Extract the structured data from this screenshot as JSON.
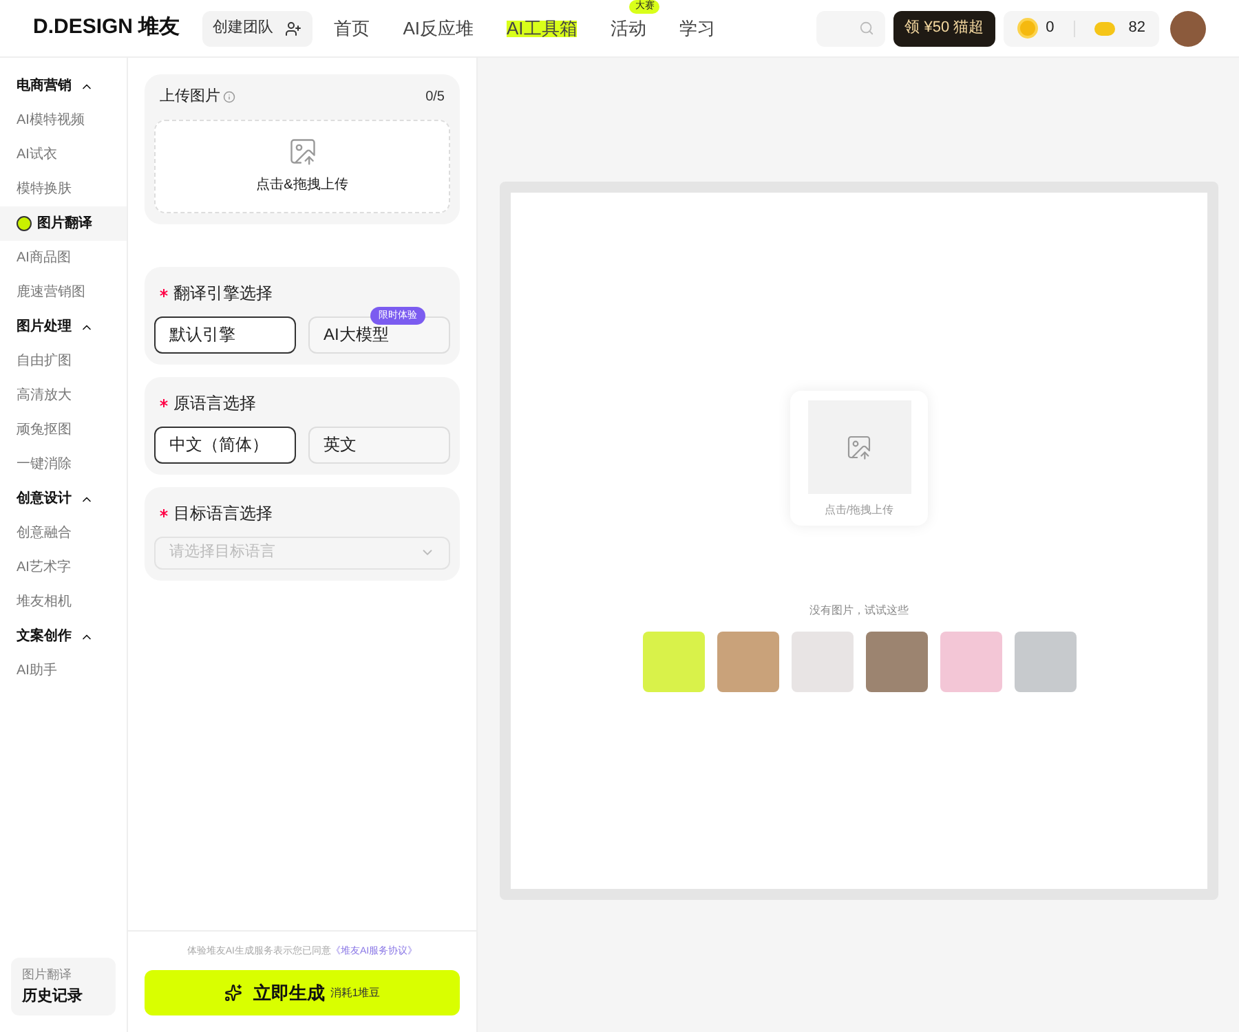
{
  "header": {
    "brand": "D.DESIGN 堆友",
    "team_button": "创建团队",
    "nav": [
      {
        "label": "首页",
        "selected": false
      },
      {
        "label": "AI反应堆",
        "selected": false
      },
      {
        "label": "AI工具箱",
        "selected": true
      },
      {
        "label": "活动",
        "selected": false,
        "badge": "大赛"
      },
      {
        "label": "学习",
        "selected": false
      }
    ],
    "promo": "领 ¥50 猫超",
    "coins": "0",
    "beans": "82"
  },
  "sidebar": {
    "groups": [
      {
        "title": "电商营销",
        "expanded": true,
        "items": [
          {
            "label": "AI模特视频",
            "selected": false
          },
          {
            "label": "AI试衣",
            "selected": false
          },
          {
            "label": "模特换肤",
            "selected": false
          },
          {
            "label": "图片翻译",
            "selected": true
          },
          {
            "label": "AI商品图",
            "selected": false
          },
          {
            "label": "鹿速营销图",
            "selected": false
          }
        ]
      },
      {
        "title": "图片处理",
        "expanded": true,
        "items": [
          {
            "label": "自由扩图",
            "selected": false
          },
          {
            "label": "高清放大",
            "selected": false
          },
          {
            "label": "顽兔抠图",
            "selected": false
          },
          {
            "label": "一键消除",
            "selected": false
          }
        ]
      },
      {
        "title": "创意设计",
        "expanded": true,
        "items": [
          {
            "label": "创意融合",
            "selected": false
          },
          {
            "label": "AI艺术字",
            "selected": false
          },
          {
            "label": "堆友相机",
            "selected": false
          }
        ]
      },
      {
        "title": "文案创作",
        "expanded": true,
        "items": [
          {
            "label": "AI助手",
            "selected": false
          }
        ]
      }
    ],
    "history": {
      "caption": "图片翻译",
      "title": "历史记录"
    }
  },
  "panel": {
    "upload": {
      "title": "上传图片",
      "count": "0/5",
      "drop_text": "点击&拖拽上传"
    },
    "engine": {
      "title": "翻译引擎选择",
      "required": true,
      "options": [
        {
          "label": "默认引擎",
          "selected": true
        },
        {
          "label": "AI大模型",
          "selected": false,
          "badge": "限时体验"
        }
      ]
    },
    "source_language": {
      "title": "原语言选择",
      "required": true,
      "options": [
        {
          "label": "中文（简体）",
          "selected": true
        },
        {
          "label": "英文",
          "selected": false
        }
      ]
    },
    "target_language": {
      "title": "目标语言选择",
      "required": true,
      "placeholder": "请选择目标语言"
    },
    "agreement": {
      "text": "体验堆友AI生成服务表示您已同意",
      "link": "《堆友AI服务协议》"
    },
    "generate": {
      "label": "立即生成",
      "cost": "消耗1堆豆"
    }
  },
  "canvas": {
    "drop_text": "点击/拖拽上传",
    "hint": "没有图片，试试这些",
    "samples": [
      {
        "color": "#d9f24a"
      },
      {
        "color": "#c9a27a"
      },
      {
        "color": "#e8e4e4"
      },
      {
        "color": "#9c8470"
      },
      {
        "color": "#f3c6d6"
      },
      {
        "color": "#c7cacd"
      }
    ]
  }
}
